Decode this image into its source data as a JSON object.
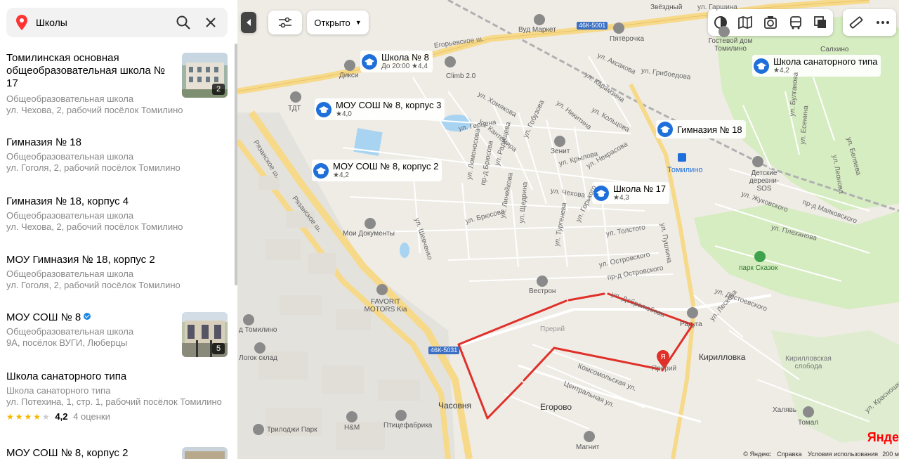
{
  "search": {
    "value": "Школы",
    "search_icon": "search-icon",
    "clear_icon": "close-icon"
  },
  "results": [
    {
      "title": "Томилинская основная общеобразовательная школа № 17",
      "category": "Общеобразовательная школа",
      "address": "ул. Чехова, 2, рабочий посёлок Томилино",
      "photo_count": "2"
    },
    {
      "title": "Гимназия № 18",
      "category": "Общеобразовательная школа",
      "address": "ул. Гоголя, 2, рабочий посёлок Томилино"
    },
    {
      "title": "Гимназия № 18, корпус 4",
      "category": "Общеобразовательная школа",
      "address": "ул. Чехова, 2, рабочий посёлок Томилино"
    },
    {
      "title": "МОУ Гимназия № 18, корпус 2",
      "category": "Общеобразовательная школа",
      "address": "ул. Гоголя, 2, рабочий посёлок Томилино"
    },
    {
      "title": "МОУ СОШ № 8",
      "category": "Общеобразовательная школа",
      "address": "9А, посёлок ВУГИ, Люберцы",
      "photo_count": "5",
      "verified": true
    },
    {
      "title": "Школа санаторного типа",
      "category": "Школа санаторного типа",
      "address": "ул. Потехина, 1, стр. 1, рабочий посёлок Томилино",
      "rating": "4,2",
      "reviews": "4 оценки",
      "stars": 4
    },
    {
      "title": "МОУ СОШ № 8, корпус 2"
    }
  ],
  "map_controls": {
    "open_filter": "Открыто",
    "layers": [
      "traffic-icon",
      "map-layers-icon",
      "panorama-icon",
      "transit-icon",
      "map-type-icon"
    ],
    "tools": [
      "ruler-icon",
      "more-icon"
    ]
  },
  "pois": [
    {
      "name": "Школа № 8",
      "sub": "До 20:00",
      "rating": "4,4"
    },
    {
      "name": "МОУ СОШ № 8, корпус 3",
      "rating": "4,0"
    },
    {
      "name": "МОУ СОШ № 8, корпус 2",
      "rating": "4,2"
    },
    {
      "name": "Школа № 17",
      "rating": "4,3"
    },
    {
      "name": "Гимназия № 18"
    },
    {
      "name": "Школа санаторного типа",
      "rating": "4,2"
    }
  ],
  "map_labels": {
    "vud_market": "Вуд Маркет",
    "pyaterochka": "Пятёрочка",
    "guest_house": "Гостевой дом Томилино",
    "salkhino": "Салхино",
    "dixy": "Дикси",
    "tdt": "ТДТ",
    "climb": "Climb 2.0",
    "zenit": "Зенит",
    "tomilino": "Томилино",
    "children_village": "Детские деревни-SOS",
    "my_docs": "Мои Документы",
    "vestron": "Вестрон",
    "favorit": "FAVORIT MOTORS Kia",
    "park": "парк Сказок",
    "raduga": "Радуга",
    "preriy1": "Прерий",
    "preriy2": "Прерий",
    "kirillovka": "Кирилловка",
    "kirillovka_sloboda": "Кирилловская слобода",
    "khalyav": "Халявь",
    "tomal": "Томал",
    "chasovnya": "Часовня",
    "egorovo": "Егорово",
    "trilodzhi": "Трилоджи Парк",
    "hm": "H&M",
    "ptitsefabrika": "Птицефабрика",
    "magnit": "Магнит",
    "d_tomilino": "д Томилино",
    "logok": "Логок склад",
    "zvezdny": "Звёздный",
    "ul_garshina": "ул. Гаршина",
    "egor_sh": "Егорьевское ш.",
    "ryaz_sh": "Рязанское ш.",
    "ryaz_sh2": "Рязанское ш.",
    "badge1": "46К-5001",
    "badge2": "46К-5031",
    "ul_nikitina": "ул. Никитина",
    "ul_chekhova": "ул. Чехова",
    "ul_tolstogo": "ул. Толстого",
    "ul_ostrovskogo": "ул. Островского",
    "ul_pushkina": "ул. Пушкина",
    "ul_zhukovskogo": "ул. Жуковского",
    "ul_plekhanova": "ул. Плеханова",
    "ul_dostoevskogo": "ул. Достоевского",
    "ul_leskova": "ул. Лескова",
    "ul_komsomolskaya": "Комсомольская ул.",
    "ul_centralnaya": "Центральная ул.",
    "ul_dobrolyubova": "ул. Добролюбова",
    "ul_gogolya": "ул. Гоголя",
    "ul_krylova": "ул. Крылова",
    "ul_nekrasova": "ул. Некрасова",
    "ul_turgeneva": "ул. Тургенева",
    "ul_gorkogo": "ул. Горького",
    "ul_bryusova": "ул. Брюсова",
    "ul_shevchenko": "ул. Шевченко",
    "ul_lomonosova": "ул. Ломоносова",
    "ul_gertsena": "ул. Герцена",
    "ul_koltsova": "ул. Кольцова",
    "ul_griboedova": "ул. Грибоедова",
    "ul_aksakova": "ул. Аксакова",
    "ul_karamzina": "ул. Карамзина",
    "ul_khomyakova": "ул. Хомякова",
    "ul_kantemira": "ул. Кантемира",
    "ul_gobuzova": "ул. Гобузова",
    "ul_radishcheva": "ул. Радищева",
    "ul_lineykova": "ул. Линейкова",
    "ul_shchedrina": "ул. Щедрина",
    "ul_bulgakova": "ул. Булгакова",
    "ul_esenina": "ул. Есенина",
    "ul_leonova": "ул. Леонова",
    "ul_belyaeva": "ул. Беляева",
    "pr_mayakovskogo": "пр-д Маяковского",
    "pr_ostrovskogo": "пр-д Островского",
    "pr_bryusova": "пр-д Брюсова",
    "ul_krasnoshkolnaya": "ул. Красношкольная",
    "tomilinskaya": "Томилинская"
  },
  "attribution": {
    "copyright": "© Яндекс",
    "help": "Справка",
    "terms": "Условия использования",
    "logo": "Янде",
    "scale": "200 м"
  },
  "colors": {
    "accent": "#1e6fd9",
    "route": "#e0302a",
    "park": "#d6ecc1",
    "road_major": "#f7d98a",
    "water": "#a8d4f2"
  }
}
